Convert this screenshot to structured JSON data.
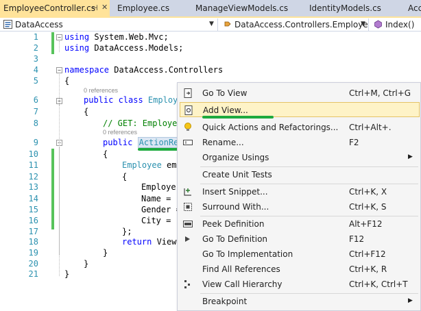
{
  "tabs": [
    {
      "label": "EmployeeController.cs",
      "active": true,
      "pin_glyph": "⊣",
      "close_glyph": "✕"
    },
    {
      "label": "Employee.cs",
      "active": false
    },
    {
      "label": "ManageViewModels.cs",
      "active": false
    },
    {
      "label": "IdentityModels.cs",
      "active": false
    },
    {
      "label": "Acc",
      "active": false
    }
  ],
  "navbar": {
    "project": {
      "label": "DataAccess",
      "icon": "csharp-project-icon"
    },
    "type": {
      "label": "DataAccess.Controllers.EmployeeC",
      "icon": "class-icon"
    },
    "member": {
      "label": "Index()",
      "icon": "method-icon"
    },
    "dropdown_glyph": "▼"
  },
  "editor": {
    "line_numbers": [
      "1",
      "2",
      "3",
      "4",
      "5",
      "6",
      "7",
      "8",
      "9",
      "10",
      "11",
      "12",
      "13",
      "14",
      "15",
      "16",
      "17",
      "18",
      "19",
      "20",
      "21"
    ],
    "lines": {
      "l1_kw": "using",
      "l1_rest": " System.Web.Mvc;",
      "l2_kw": "using",
      "l2_rest": " DataAccess.Models;",
      "l4_kw": "namespace",
      "l4_rest": " DataAccess.Controllers",
      "l5": "{",
      "l6_kw": "public class",
      "l6_ty": " Employe",
      "l7": "{",
      "l8_cm": "// GET: Employee",
      "l9_kw": "public",
      "l9_ty": "ActionRes",
      "l10": "{",
      "l11_ty": "Employee",
      "l11_rest": " emp",
      "l12": "{",
      "l13": "Employe",
      "l14": "Name = '",
      "l15": "Gender =",
      "l16": "City = '",
      "l17": "};",
      "l18_kw": "return",
      "l18_rest": " View(",
      "l19": "}",
      "l20": "}",
      "l21": "}"
    },
    "references": [
      "0 references",
      "0 references"
    ],
    "fold_minus": "−"
  },
  "context_menu": {
    "items": [
      {
        "label": "Go To View",
        "shortcut": "Ctrl+M, Ctrl+G",
        "icon": "go-to-view-icon"
      },
      {
        "label": "Add View...",
        "shortcut": "",
        "icon": "add-view-icon",
        "highlighted": true
      },
      {
        "label": "Quick Actions and Refactorings...",
        "shortcut": "Ctrl+Alt+.",
        "icon": "lightbulb-icon"
      },
      {
        "label": "Rename...",
        "shortcut": "F2",
        "icon": "rename-icon"
      },
      {
        "label": "Organize Usings",
        "shortcut": "",
        "submenu": true
      },
      {
        "label": "Create Unit Tests",
        "shortcut": ""
      },
      {
        "label": "Insert Snippet...",
        "shortcut": "Ctrl+K, X",
        "icon": "insert-snippet-icon"
      },
      {
        "label": "Surround With...",
        "shortcut": "Ctrl+K, S",
        "icon": "surround-with-icon"
      },
      {
        "label": "Peek Definition",
        "shortcut": "Alt+F12",
        "icon": "peek-definition-icon"
      },
      {
        "label": "Go To Definition",
        "shortcut": "F12",
        "icon": "go-to-definition-icon"
      },
      {
        "label": "Go To Implementation",
        "shortcut": "Ctrl+F12"
      },
      {
        "label": "Find All References",
        "shortcut": "Ctrl+K, R"
      },
      {
        "label": "View Call Hierarchy",
        "shortcut": "Ctrl+K, Ctrl+T",
        "icon": "call-hierarchy-icon"
      },
      {
        "label": "Breakpoint",
        "shortcut": "",
        "submenu": true
      }
    ],
    "submenu_glyph": "▶"
  },
  "colors": {
    "tab_active": "#ffe39a",
    "tab_strip": "#cfd6e5",
    "keyword": "#0000ff",
    "type": "#2b91af",
    "comment": "#008000",
    "line_number": "#2b91af",
    "change_bar": "#57c35b",
    "annotation_underline": "#1eaa3e",
    "menu_highlight": "#fef3c7"
  }
}
